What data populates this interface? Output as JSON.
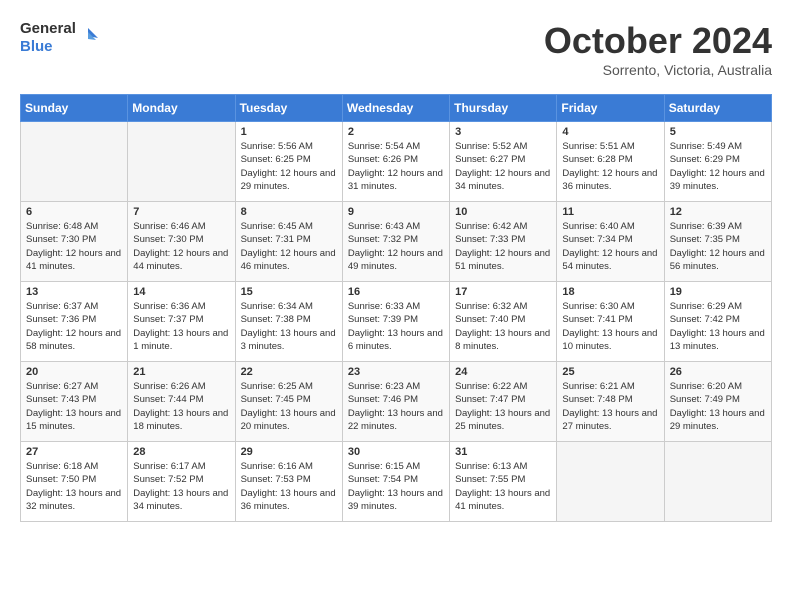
{
  "header": {
    "logo_general": "General",
    "logo_blue": "Blue",
    "month_title": "October 2024",
    "subtitle": "Sorrento, Victoria, Australia"
  },
  "weekdays": [
    "Sunday",
    "Monday",
    "Tuesday",
    "Wednesday",
    "Thursday",
    "Friday",
    "Saturday"
  ],
  "weeks": [
    [
      {
        "day": "",
        "sunrise": "",
        "sunset": "",
        "daylight": ""
      },
      {
        "day": "",
        "sunrise": "",
        "sunset": "",
        "daylight": ""
      },
      {
        "day": "1",
        "sunrise": "Sunrise: 5:56 AM",
        "sunset": "Sunset: 6:25 PM",
        "daylight": "Daylight: 12 hours and 29 minutes."
      },
      {
        "day": "2",
        "sunrise": "Sunrise: 5:54 AM",
        "sunset": "Sunset: 6:26 PM",
        "daylight": "Daylight: 12 hours and 31 minutes."
      },
      {
        "day": "3",
        "sunrise": "Sunrise: 5:52 AM",
        "sunset": "Sunset: 6:27 PM",
        "daylight": "Daylight: 12 hours and 34 minutes."
      },
      {
        "day": "4",
        "sunrise": "Sunrise: 5:51 AM",
        "sunset": "Sunset: 6:28 PM",
        "daylight": "Daylight: 12 hours and 36 minutes."
      },
      {
        "day": "5",
        "sunrise": "Sunrise: 5:49 AM",
        "sunset": "Sunset: 6:29 PM",
        "daylight": "Daylight: 12 hours and 39 minutes."
      }
    ],
    [
      {
        "day": "6",
        "sunrise": "Sunrise: 6:48 AM",
        "sunset": "Sunset: 7:30 PM",
        "daylight": "Daylight: 12 hours and 41 minutes."
      },
      {
        "day": "7",
        "sunrise": "Sunrise: 6:46 AM",
        "sunset": "Sunset: 7:30 PM",
        "daylight": "Daylight: 12 hours and 44 minutes."
      },
      {
        "day": "8",
        "sunrise": "Sunrise: 6:45 AM",
        "sunset": "Sunset: 7:31 PM",
        "daylight": "Daylight: 12 hours and 46 minutes."
      },
      {
        "day": "9",
        "sunrise": "Sunrise: 6:43 AM",
        "sunset": "Sunset: 7:32 PM",
        "daylight": "Daylight: 12 hours and 49 minutes."
      },
      {
        "day": "10",
        "sunrise": "Sunrise: 6:42 AM",
        "sunset": "Sunset: 7:33 PM",
        "daylight": "Daylight: 12 hours and 51 minutes."
      },
      {
        "day": "11",
        "sunrise": "Sunrise: 6:40 AM",
        "sunset": "Sunset: 7:34 PM",
        "daylight": "Daylight: 12 hours and 54 minutes."
      },
      {
        "day": "12",
        "sunrise": "Sunrise: 6:39 AM",
        "sunset": "Sunset: 7:35 PM",
        "daylight": "Daylight: 12 hours and 56 minutes."
      }
    ],
    [
      {
        "day": "13",
        "sunrise": "Sunrise: 6:37 AM",
        "sunset": "Sunset: 7:36 PM",
        "daylight": "Daylight: 12 hours and 58 minutes."
      },
      {
        "day": "14",
        "sunrise": "Sunrise: 6:36 AM",
        "sunset": "Sunset: 7:37 PM",
        "daylight": "Daylight: 13 hours and 1 minute."
      },
      {
        "day": "15",
        "sunrise": "Sunrise: 6:34 AM",
        "sunset": "Sunset: 7:38 PM",
        "daylight": "Daylight: 13 hours and 3 minutes."
      },
      {
        "day": "16",
        "sunrise": "Sunrise: 6:33 AM",
        "sunset": "Sunset: 7:39 PM",
        "daylight": "Daylight: 13 hours and 6 minutes."
      },
      {
        "day": "17",
        "sunrise": "Sunrise: 6:32 AM",
        "sunset": "Sunset: 7:40 PM",
        "daylight": "Daylight: 13 hours and 8 minutes."
      },
      {
        "day": "18",
        "sunrise": "Sunrise: 6:30 AM",
        "sunset": "Sunset: 7:41 PM",
        "daylight": "Daylight: 13 hours and 10 minutes."
      },
      {
        "day": "19",
        "sunrise": "Sunrise: 6:29 AM",
        "sunset": "Sunset: 7:42 PM",
        "daylight": "Daylight: 13 hours and 13 minutes."
      }
    ],
    [
      {
        "day": "20",
        "sunrise": "Sunrise: 6:27 AM",
        "sunset": "Sunset: 7:43 PM",
        "daylight": "Daylight: 13 hours and 15 minutes."
      },
      {
        "day": "21",
        "sunrise": "Sunrise: 6:26 AM",
        "sunset": "Sunset: 7:44 PM",
        "daylight": "Daylight: 13 hours and 18 minutes."
      },
      {
        "day": "22",
        "sunrise": "Sunrise: 6:25 AM",
        "sunset": "Sunset: 7:45 PM",
        "daylight": "Daylight: 13 hours and 20 minutes."
      },
      {
        "day": "23",
        "sunrise": "Sunrise: 6:23 AM",
        "sunset": "Sunset: 7:46 PM",
        "daylight": "Daylight: 13 hours and 22 minutes."
      },
      {
        "day": "24",
        "sunrise": "Sunrise: 6:22 AM",
        "sunset": "Sunset: 7:47 PM",
        "daylight": "Daylight: 13 hours and 25 minutes."
      },
      {
        "day": "25",
        "sunrise": "Sunrise: 6:21 AM",
        "sunset": "Sunset: 7:48 PM",
        "daylight": "Daylight: 13 hours and 27 minutes."
      },
      {
        "day": "26",
        "sunrise": "Sunrise: 6:20 AM",
        "sunset": "Sunset: 7:49 PM",
        "daylight": "Daylight: 13 hours and 29 minutes."
      }
    ],
    [
      {
        "day": "27",
        "sunrise": "Sunrise: 6:18 AM",
        "sunset": "Sunset: 7:50 PM",
        "daylight": "Daylight: 13 hours and 32 minutes."
      },
      {
        "day": "28",
        "sunrise": "Sunrise: 6:17 AM",
        "sunset": "Sunset: 7:52 PM",
        "daylight": "Daylight: 13 hours and 34 minutes."
      },
      {
        "day": "29",
        "sunrise": "Sunrise: 6:16 AM",
        "sunset": "Sunset: 7:53 PM",
        "daylight": "Daylight: 13 hours and 36 minutes."
      },
      {
        "day": "30",
        "sunrise": "Sunrise: 6:15 AM",
        "sunset": "Sunset: 7:54 PM",
        "daylight": "Daylight: 13 hours and 39 minutes."
      },
      {
        "day": "31",
        "sunrise": "Sunrise: 6:13 AM",
        "sunset": "Sunset: 7:55 PM",
        "daylight": "Daylight: 13 hours and 41 minutes."
      },
      {
        "day": "",
        "sunrise": "",
        "sunset": "",
        "daylight": ""
      },
      {
        "day": "",
        "sunrise": "",
        "sunset": "",
        "daylight": ""
      }
    ]
  ]
}
